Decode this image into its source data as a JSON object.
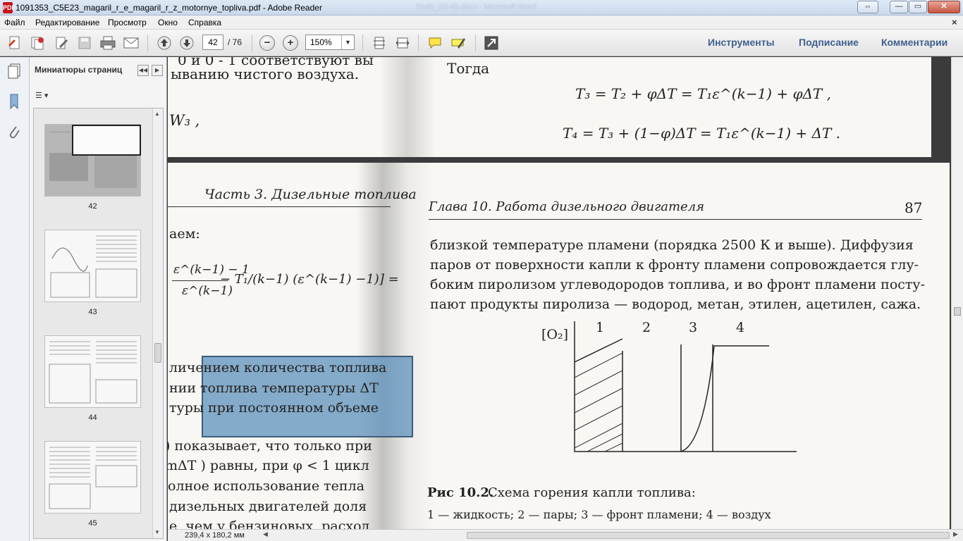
{
  "window": {
    "title": "1091353_C5E23_magaril_r_e_magaril_r_z_motornye_topliva.pdf - Adobe Reader",
    "background_window_title": "Drafy_03-48.docx - Microsoft Word",
    "app_icon_label": "PDF",
    "controls": {
      "switch": "⇔",
      "minimize": "—",
      "maximize": "▭",
      "close": "✕"
    }
  },
  "menu": {
    "items": [
      "Файл",
      "Редактирование",
      "Просмотр",
      "Окно",
      "Справка"
    ],
    "close_doc": "×"
  },
  "toolbar": {
    "page_number": "42",
    "page_total": "/ 76",
    "zoom": "150%",
    "zoom_arrow": "▼",
    "zoom_out_glyph": "−",
    "zoom_in_glyph": "+",
    "panel_links": [
      "Инструменты",
      "Подписание",
      "Комментарии"
    ]
  },
  "sidebar": {
    "title": "Миниатюры страниц",
    "collapse_glyph": "◀◀",
    "expand_glyph": "▶",
    "options_glyph": "☰ ▾",
    "thumbnails": [
      {
        "label": "42",
        "selected": true
      },
      {
        "label": "43",
        "selected": false
      },
      {
        "label": "44",
        "selected": false
      },
      {
        "label": "45",
        "selected": false
      }
    ],
    "scroll_up": "▲",
    "scroll_down": "▼"
  },
  "document": {
    "prev_page": {
      "line1": "0 и 0 - 1 соответствуют вы",
      "line2": "ыванию чистого воздуха.",
      "w3": "W₃ ,",
      "togda": "Тогда",
      "eq1": "T₃ = T₂ + φΔT = T₁ε^(k−1) + φΔT ,",
      "eq2": "T₄ = T₃ + (1−φ)ΔT = T₁ε^(k−1) + ΔT ."
    },
    "left_page": {
      "header": "Часть 3. Дизельные топлива",
      "l1": "аем:",
      "frac_num": "ε^(k−1) − 1",
      "frac_den": "ε^(k−1)",
      "frac2": "− T₁/(k−1) (ε^(k−1) −1)] =",
      "body": [
        "личением количества топлива",
        "нии топлива температуры ΔT",
        "туры при постоянном объеме",
        ") показывает, что только при",
        "mΔT ) равны, при  φ < 1  цикл",
        "олное использование тепла",
        "дизельных двигателей доля",
        "е, чем у бензиновых, расход"
      ]
    },
    "right_page": {
      "header": "Глава 10. Работа дизельного двигателя",
      "page_num": "87",
      "body": [
        "близкой температуре пламени (порядка 2500 К и выше). Диффузия",
        "паров от поверхности капли к фронту пламени сопровождается глу-",
        "боким пиролизом углеводородов топлива, и во фронт пламени посту-",
        "пают продукты пиролиза — водород, метан, этилен, ацетилен, сажа."
      ],
      "figure": {
        "ylabel": "[O₂]",
        "zones": [
          "1",
          "2",
          "3",
          "4"
        ]
      },
      "caption_bold": "Рис 10.2.",
      "caption": "Схема горения капли топлива:",
      "legend": "1 — жидкость; 2 — пары; 3 — фронт пламени; 4 — воздух"
    }
  },
  "status": {
    "dimensions": "239,4 x 180,2 мм",
    "left_arrow": "◀",
    "right_arrow": "▶"
  }
}
